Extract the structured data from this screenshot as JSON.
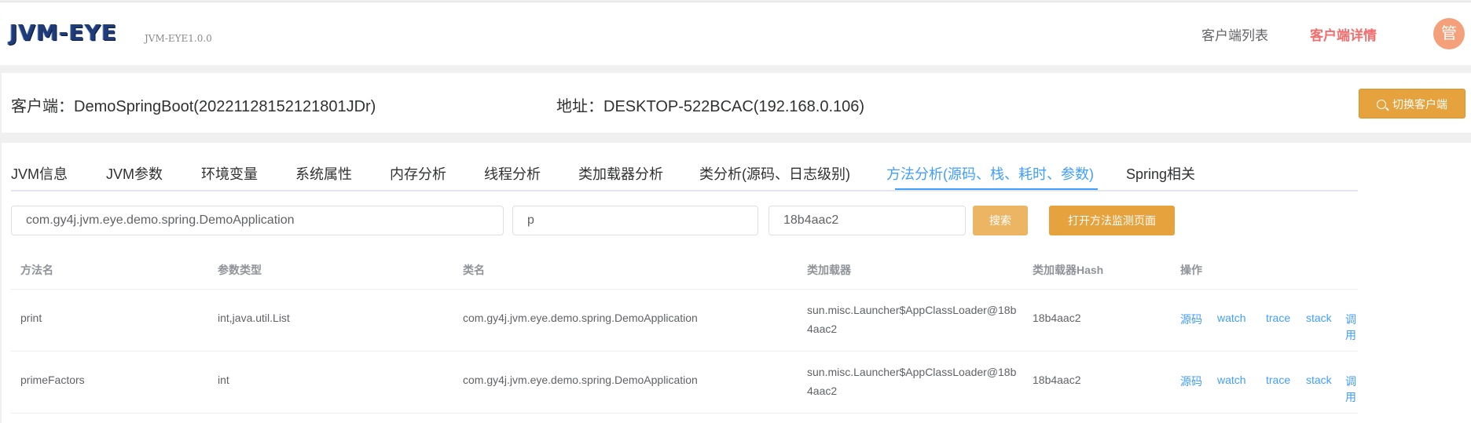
{
  "header": {
    "logo": "JVM-EYE",
    "version": "JVM-EYE1.0.0",
    "nav": [
      "客户端列表",
      "客户端详情"
    ],
    "avatar": "管"
  },
  "client": {
    "name": "客户端：DemoSpringBoot(20221128152121801JDr)",
    "address": "地址：DESKTOP-522BCAC(192.168.0.106)",
    "switch_button": "切换客户端"
  },
  "tabs": [
    "JVM信息",
    "JVM参数",
    "环境变量",
    "系统属性",
    "内存分析",
    "线程分析",
    "类加载器分析",
    "类分析(源码、日志级别)",
    "方法分析(源码、栈、耗时、参数)",
    "Spring相关"
  ],
  "active_tab": "方法分析(源码、栈、耗时、参数)",
  "search": {
    "class_value": "com.gy4j.jvm.eye.demo.spring.DemoApplication",
    "method_value": "p",
    "hash_value": "18b4aac2",
    "search_button": "搜索",
    "open_button": "打开方法监测页面"
  },
  "table": {
    "columns": [
      "方法名",
      "参数类型",
      "类名",
      "类加载器",
      "类加载器Hash",
      "操作"
    ],
    "rows": [
      {
        "method": "print",
        "params": "int,java.util.List",
        "class": "com.gy4j.jvm.eye.demo.spring.DemoApplication",
        "loader": "sun.misc.Launcher$AppClassLoader@18b4aac2",
        "hash": "18b4aac2",
        "actions": [
          "源码",
          "watch",
          "trace",
          "stack",
          "调用"
        ]
      },
      {
        "method": "primeFactors",
        "params": "int",
        "class": "com.gy4j.jvm.eye.demo.spring.DemoApplication",
        "loader": "sun.misc.Launcher$AppClassLoader@18b4aac2",
        "hash": "18b4aac2",
        "actions": [
          "源码",
          "watch",
          "trace",
          "stack",
          "调用"
        ]
      }
    ]
  },
  "colors": {
    "accent": "#409eff",
    "warning": "#e6a23c",
    "danger": "#f56c6c",
    "avatar": "#f4a07a"
  },
  "icons": {
    "switch_button": "search-icon"
  }
}
